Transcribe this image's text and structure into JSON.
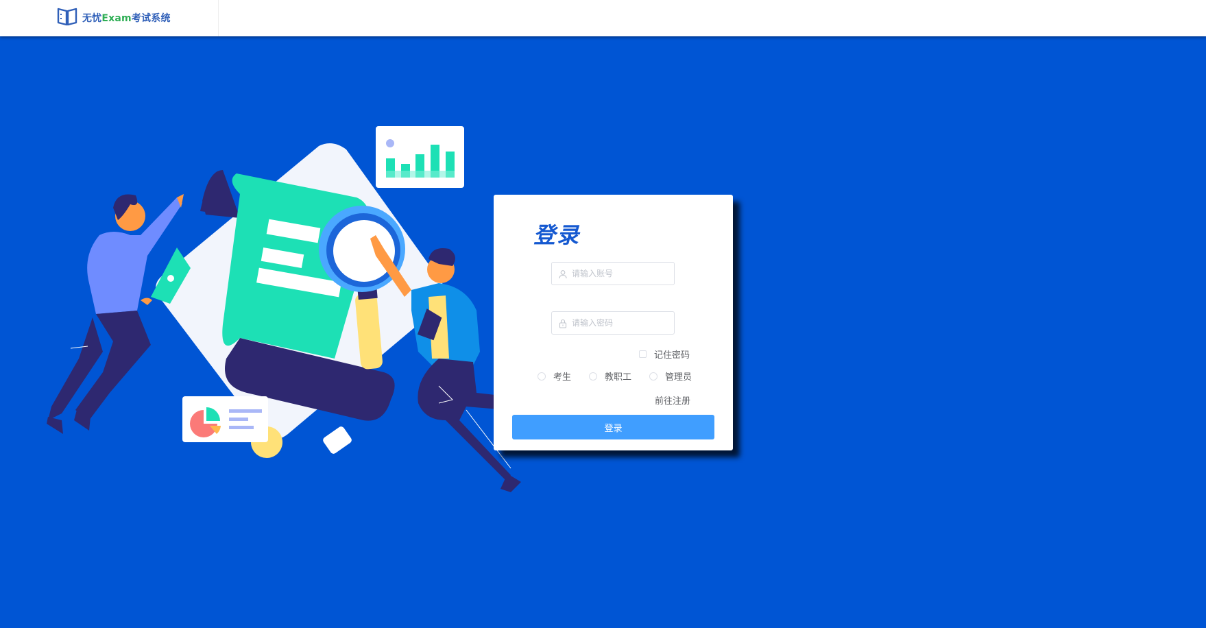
{
  "header": {
    "brand_part1": "无忧",
    "brand_exam": "Exam",
    "brand_part2": "考试系统",
    "logo_icon": "open-book-icon"
  },
  "login": {
    "title": "登录",
    "account_placeholder": "请输入账号",
    "password_placeholder": "请输入密码",
    "remember_label": "记住密码",
    "roles": [
      {
        "label": "考生"
      },
      {
        "label": "教职工"
      },
      {
        "label": "管理员"
      }
    ],
    "register_link": "前往注册",
    "submit_label": "登录"
  },
  "colors": {
    "background": "#0055d4",
    "primary_button": "#409eff",
    "title": "#1458d0",
    "brand_blue": "#2f5fb8",
    "brand_green": "#2fae55"
  },
  "icons": {
    "account": "user-icon",
    "password": "lock-icon"
  }
}
